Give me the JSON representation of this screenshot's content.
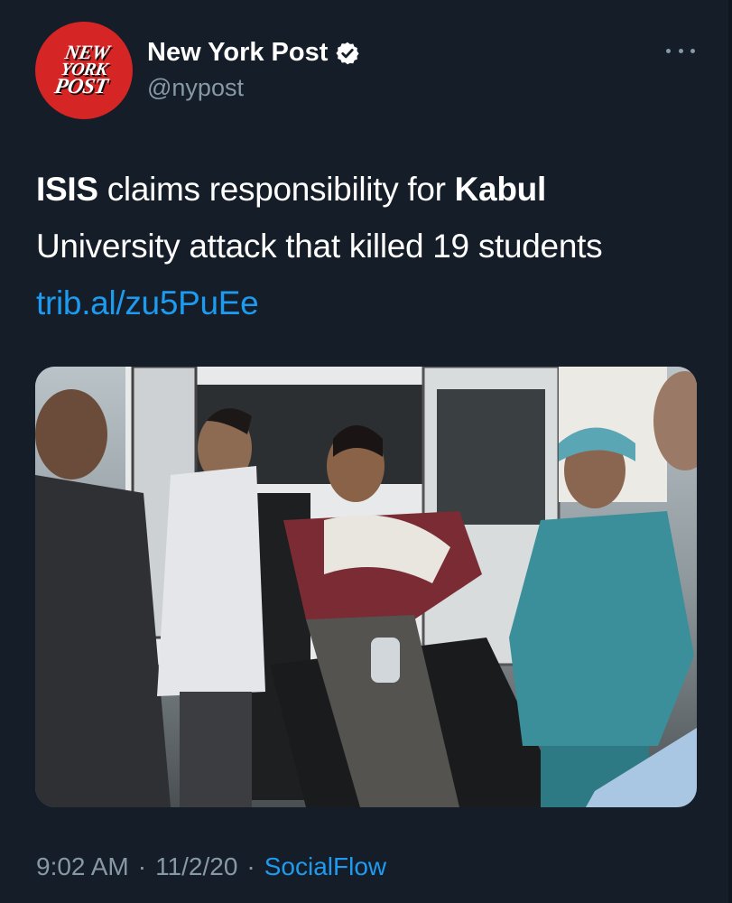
{
  "author": {
    "display_name": "New York Post",
    "handle": "@nypost",
    "verified": true,
    "avatar_logo_lines": [
      "NEW",
      "YORK",
      "POST"
    ],
    "avatar_color": "#d62525"
  },
  "tweet": {
    "segments": [
      {
        "text": "ISIS",
        "style": "bold"
      },
      {
        "text": " claims responsibility for ",
        "style": "normal"
      },
      {
        "text": "Kabul",
        "style": "bold"
      },
      {
        "text": " University attack that killed 19 students ",
        "style": "normal"
      },
      {
        "text": "trib.al/zu5PuEe",
        "style": "link"
      }
    ],
    "link": "trib.al/zu5PuEe"
  },
  "media": {
    "type": "photo",
    "description_icon": "news-photo"
  },
  "meta": {
    "time": "9:02 AM",
    "date": "11/2/20",
    "source": "SocialFlow",
    "separator": "·"
  },
  "icons": {
    "more": "more-horizontal-icon",
    "verified": "verified-badge-icon"
  },
  "colors": {
    "background": "#151d28",
    "link": "#1d9bf0",
    "secondary_text": "#8899a6",
    "verified": "#ffffff"
  }
}
